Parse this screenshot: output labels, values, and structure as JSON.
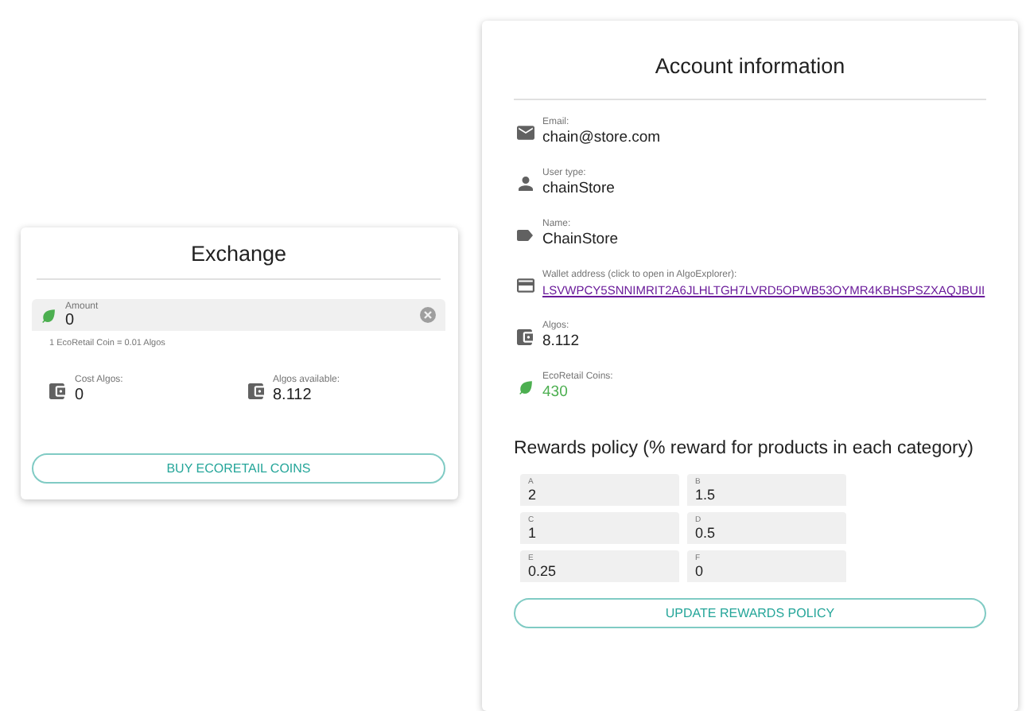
{
  "exchange": {
    "title": "Exchange",
    "amount": {
      "label": "Amount",
      "value": "0"
    },
    "hint": "1 EcoRetail Coin = 0.01 Algos",
    "stats": [
      {
        "label": "Cost Algos:",
        "value": "0"
      },
      {
        "label": "Algos available:",
        "value": "8.112"
      }
    ],
    "button": "BUY ECORETAIL COINS"
  },
  "account": {
    "title": "Account information",
    "rows": [
      {
        "kind": "email",
        "label": "Email:",
        "value": "chain@store.com"
      },
      {
        "kind": "user",
        "label": "User type:",
        "value": "chainStore"
      },
      {
        "kind": "name",
        "label": "Name:",
        "value": "ChainStore"
      },
      {
        "kind": "wallet",
        "label": "Wallet address (click to open in AlgoExplorer):",
        "value": "LSVWPCY5SNNIMRIT2A6JLHLTGH7LVRD5OPWB53OYMR4KBHSPSZXAQJBUII"
      },
      {
        "kind": "algos",
        "label": "Algos:",
        "value": "8.112"
      },
      {
        "kind": "coins",
        "label": "EcoRetail Coins:",
        "value": "430"
      }
    ]
  },
  "rewards": {
    "title": "Rewards policy (% reward for products in each category)",
    "fields": [
      {
        "label": "A",
        "value": "2"
      },
      {
        "label": "B",
        "value": "1.5"
      },
      {
        "label": "C",
        "value": "1"
      },
      {
        "label": "D",
        "value": "0.5"
      },
      {
        "label": "E",
        "value": "0.25"
      },
      {
        "label": "F",
        "value": "0"
      }
    ],
    "button": "UPDATE REWARDS POLICY"
  }
}
